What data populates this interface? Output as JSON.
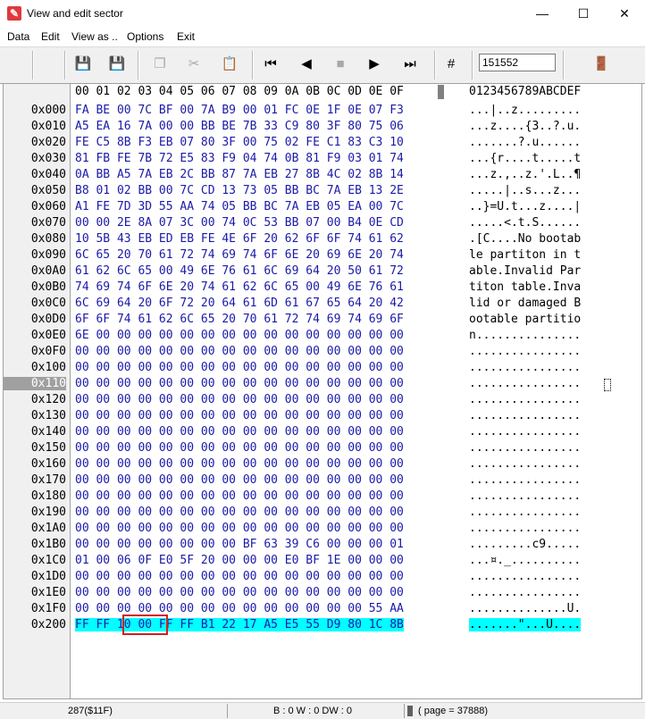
{
  "window": {
    "title": "View and edit sector",
    "minimize_icon": "minimize-icon",
    "maximize_icon": "maximize-icon",
    "close_icon": "close-icon"
  },
  "menu": {
    "items": [
      "Data",
      "Edit",
      "View as ..",
      "Options",
      "Exit"
    ]
  },
  "toolbar": {
    "page_value": "151552"
  },
  "hex": {
    "header": "00 01 02 03 04 05 06 07 08 09 0A 0B 0C 0D 0E 0F",
    "ascii_header": "0123456789ABCDEF",
    "rows": [
      {
        "addr": "0x000",
        "hex": "FA BE 00 7C BF 00 7A B9 00 01 FC 0E 1F 0E 07 F3",
        "ascii": "...|..z........."
      },
      {
        "addr": "0x010",
        "hex": "A5 EA 16 7A 00 00 BB BE 7B 33 C9 80 3F 80 75 06",
        "ascii": "...z....{3..?.u."
      },
      {
        "addr": "0x020",
        "hex": "FE C5 8B F3 EB 07 80 3F 00 75 02 FE C1 83 C3 10",
        "ascii": ".......?.u......"
      },
      {
        "addr": "0x030",
        "hex": "81 FB FE 7B 72 E5 83 F9 04 74 0B 81 F9 03 01 74",
        "ascii": "...{r....t.....t"
      },
      {
        "addr": "0x040",
        "hex": "0A BB A5 7A EB 2C BB 87 7A EB 27 8B 4C 02 8B 14",
        "ascii": "...z.,..z.'.L..¶"
      },
      {
        "addr": "0x050",
        "hex": "B8 01 02 BB 00 7C CD 13 73 05 BB BC 7A EB 13 2E",
        "ascii": ".....|..s...z..."
      },
      {
        "addr": "0x060",
        "hex": "A1 FE 7D 3D 55 AA 74 05 BB BC 7A EB 05 EA 00 7C",
        "ascii": "..}=U.t...z....|"
      },
      {
        "addr": "0x070",
        "hex": "00 00 2E 8A 07 3C 00 74 0C 53 BB 07 00 B4 0E CD",
        "ascii": ".....<.t.S......"
      },
      {
        "addr": "0x080",
        "hex": "10 5B 43 EB ED EB FE 4E 6F 20 62 6F 6F 74 61 62",
        "ascii": ".[C....No bootab"
      },
      {
        "addr": "0x090",
        "hex": "6C 65 20 70 61 72 74 69 74 6F 6E 20 69 6E 20 74",
        "ascii": "le partiton in t"
      },
      {
        "addr": "0x0A0",
        "hex": "61 62 6C 65 00 49 6E 76 61 6C 69 64 20 50 61 72",
        "ascii": "able.Invalid Par"
      },
      {
        "addr": "0x0B0",
        "hex": "74 69 74 6F 6E 20 74 61 62 6C 65 00 49 6E 76 61",
        "ascii": "titon table.Inva"
      },
      {
        "addr": "0x0C0",
        "hex": "6C 69 64 20 6F 72 20 64 61 6D 61 67 65 64 20 42",
        "ascii": "lid or damaged B"
      },
      {
        "addr": "0x0D0",
        "hex": "6F 6F 74 61 62 6C 65 20 70 61 72 74 69 74 69 6F",
        "ascii": "ootable partitio"
      },
      {
        "addr": "0x0E0",
        "hex": "6E 00 00 00 00 00 00 00 00 00 00 00 00 00 00 00",
        "ascii": "n..............."
      },
      {
        "addr": "0x0F0",
        "hex": "00 00 00 00 00 00 00 00 00 00 00 00 00 00 00 00",
        "ascii": "................"
      },
      {
        "addr": "0x100",
        "hex": "00 00 00 00 00 00 00 00 00 00 00 00 00 00 00 00",
        "ascii": "................"
      },
      {
        "addr": "0x110",
        "hex": "00 00 00 00 00 00 00 00 00 00 00 00 00 00 00 00",
        "ascii": "................"
      },
      {
        "addr": "0x120",
        "hex": "00 00 00 00 00 00 00 00 00 00 00 00 00 00 00 00",
        "ascii": "................"
      },
      {
        "addr": "0x130",
        "hex": "00 00 00 00 00 00 00 00 00 00 00 00 00 00 00 00",
        "ascii": "................"
      },
      {
        "addr": "0x140",
        "hex": "00 00 00 00 00 00 00 00 00 00 00 00 00 00 00 00",
        "ascii": "................"
      },
      {
        "addr": "0x150",
        "hex": "00 00 00 00 00 00 00 00 00 00 00 00 00 00 00 00",
        "ascii": "................"
      },
      {
        "addr": "0x160",
        "hex": "00 00 00 00 00 00 00 00 00 00 00 00 00 00 00 00",
        "ascii": "................"
      },
      {
        "addr": "0x170",
        "hex": "00 00 00 00 00 00 00 00 00 00 00 00 00 00 00 00",
        "ascii": "................"
      },
      {
        "addr": "0x180",
        "hex": "00 00 00 00 00 00 00 00 00 00 00 00 00 00 00 00",
        "ascii": "................"
      },
      {
        "addr": "0x190",
        "hex": "00 00 00 00 00 00 00 00 00 00 00 00 00 00 00 00",
        "ascii": "................"
      },
      {
        "addr": "0x1A0",
        "hex": "00 00 00 00 00 00 00 00 00 00 00 00 00 00 00 00",
        "ascii": "................"
      },
      {
        "addr": "0x1B0",
        "hex": "00 00 00 00 00 00 00 00 BF 63 39 C6 00 00 00 01",
        "ascii": ".........c9....."
      },
      {
        "addr": "0x1C0",
        "hex": "01 00 06 0F E0 5F 20 00 00 00 E0 BF 1E 00 00 00",
        "ascii": "...¤._.........."
      },
      {
        "addr": "0x1D0",
        "hex": "00 00 00 00 00 00 00 00 00 00 00 00 00 00 00 00",
        "ascii": "................"
      },
      {
        "addr": "0x1E0",
        "hex": "00 00 00 00 00 00 00 00 00 00 00 00 00 00 00 00",
        "ascii": "................"
      },
      {
        "addr": "0x1F0",
        "hex": "00 00 00 00 00 00 00 00 00 00 00 00 00 00 55 AA",
        "ascii": "..............U."
      },
      {
        "addr": "0x200",
        "hex": "FF FF 10 00 FF FF B1 22 17 A5 E5 55 D9 80 1C 8B",
        "ascii": ".......\"...U...."
      }
    ],
    "selected_row_addr": "0x110",
    "highlighted_row_addr": "0x200"
  },
  "status": {
    "position": "287($11F)",
    "counts": "B : 0 W : 0 DW : 0",
    "page": "( page = 37888)"
  },
  "colors": {
    "hex_text": "#1a1aa8",
    "highlight": "#00ffff",
    "red_box": "#d02020"
  }
}
